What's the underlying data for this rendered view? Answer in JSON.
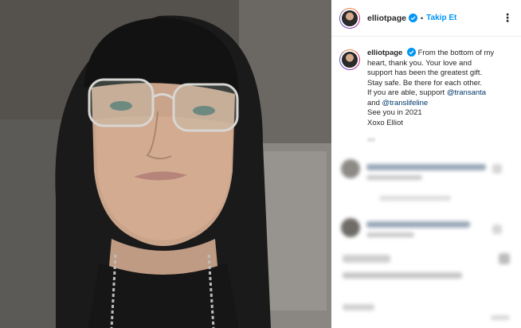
{
  "post": {
    "username": "elliotpage",
    "follow_label": "Takip Et",
    "separator": "•",
    "more_glyph": "⋮",
    "caption_username": "elliotpage",
    "caption_lines": [
      "From the bottom of my",
      "heart, thank you. Your love and",
      "support has been the greatest gift.",
      "Stay safe. Be there for each other.",
      "If you are able, support ",
      "and ",
      "See you in 2021",
      "Xoxo Elliot"
    ],
    "mention_1": "@transanta",
    "mention_2": "@translifeline"
  },
  "colors": {
    "accent": "#0095f6",
    "mention": "#00376b",
    "text": "#262626"
  },
  "icons": {
    "verified": "verified-badge-icon",
    "more": "more-options-icon"
  }
}
